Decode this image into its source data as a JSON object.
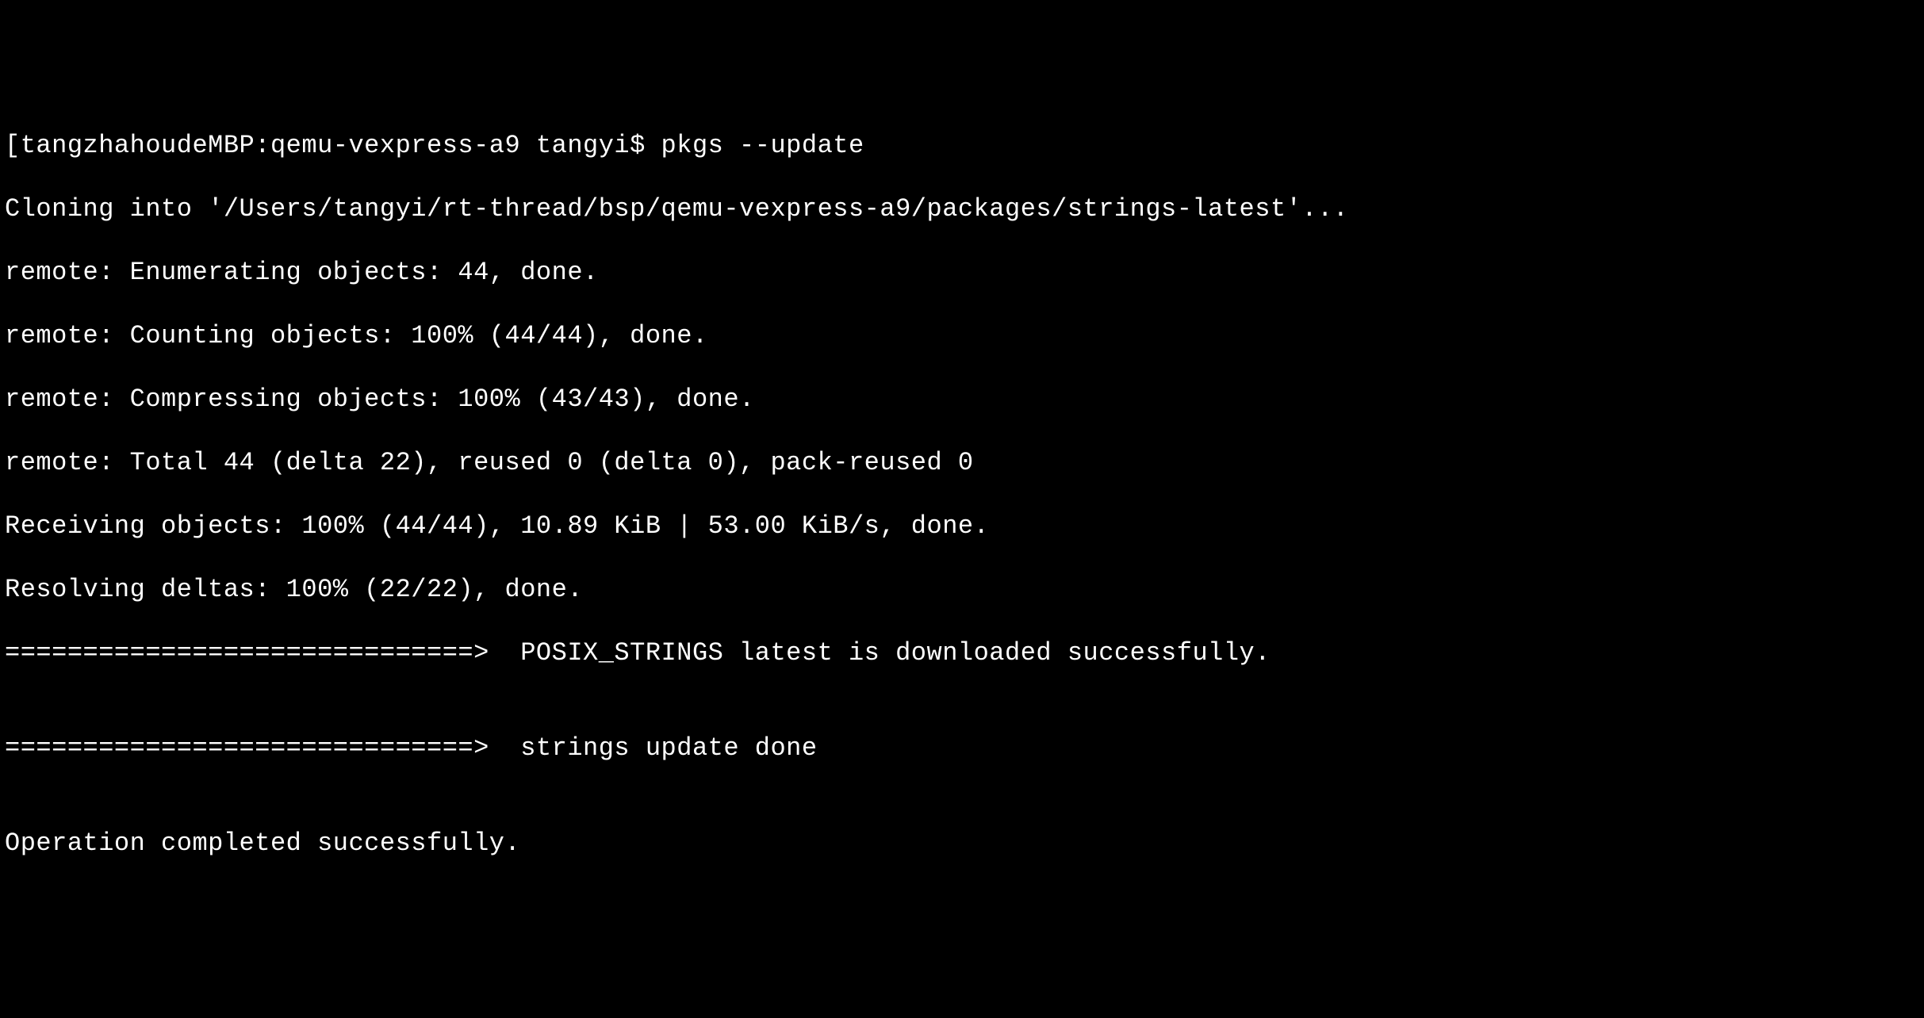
{
  "terminal": {
    "prompt_line": "[tangzhahoudeMBP:qemu-vexpress-a9 tangyi$ pkgs --update",
    "lines": [
      "Cloning into '/Users/tangyi/rt-thread/bsp/qemu-vexpress-a9/packages/strings-latest'...",
      "remote: Enumerating objects: 44, done.",
      "remote: Counting objects: 100% (44/44), done.",
      "remote: Compressing objects: 100% (43/43), done.",
      "remote: Total 44 (delta 22), reused 0 (delta 0), pack-reused 0",
      "Receiving objects: 100% (44/44), 10.89 KiB | 53.00 KiB/s, done.",
      "Resolving deltas: 100% (22/22), done.",
      "==============================>  POSIX_STRINGS latest is downloaded successfully.",
      "",
      "==============================>  strings update done",
      "",
      "Operation completed successfully."
    ]
  }
}
